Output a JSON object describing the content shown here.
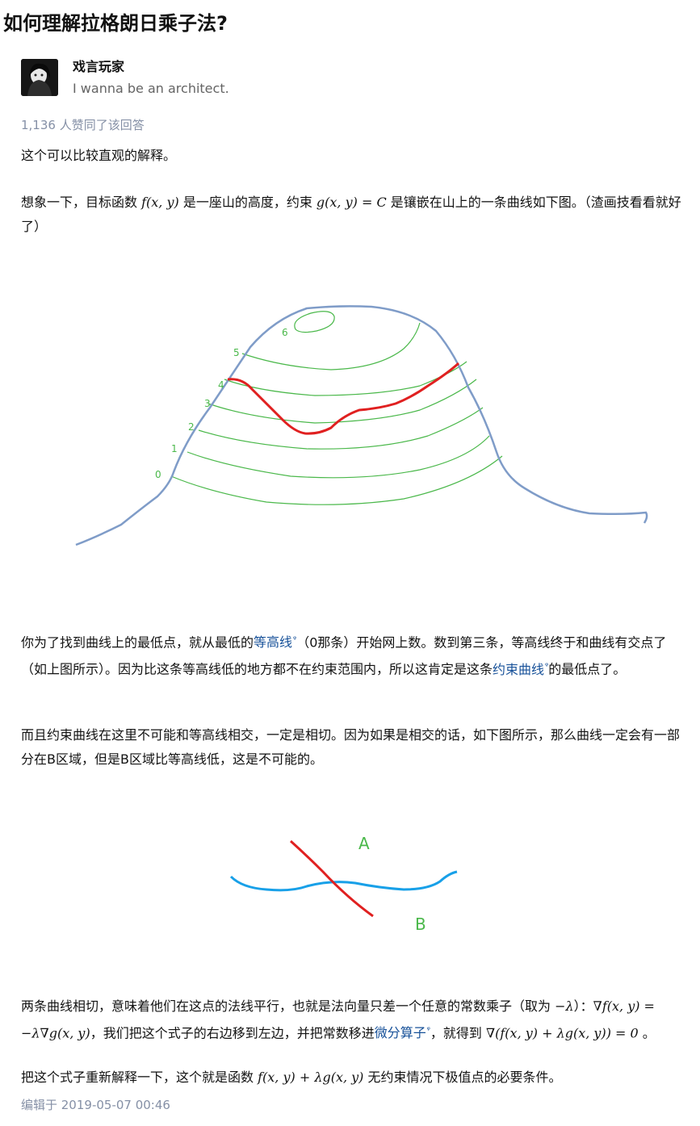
{
  "question": {
    "title": "如何理解拉格朗日乘子法?"
  },
  "author": {
    "name": "戏言玩家",
    "bio": "I wanna be an architect."
  },
  "answer": {
    "votes": "1,136 人赞同了该回答",
    "p1": "这个可以比较直观的解释。",
    "p2": {
      "a": "想象一下，目标函数 ",
      "m1": "f(x, y)",
      "b": " 是一座山的高度，约束 ",
      "m2": "g(x, y) = C",
      "c": " 是镶嵌在山上的一条曲线如下图。（渣画技看看就好了）"
    },
    "figure1": {
      "contour_labels": [
        "0",
        "1",
        "2",
        "3",
        "4",
        "5",
        "6"
      ]
    },
    "p3": {
      "a": "你为了找到曲线上的最低点，就从最低的",
      "link1": "等高线",
      "b": "（0那条）开始网上数。数到第三条，等高线终于和曲线有交点了（如上图所示）。因为比这条等高线低的地方都不在约束范围内，所以这肯定是这条",
      "link2": "约束曲线",
      "c": "的最低点了。"
    },
    "p4": "而且约束曲线在这里不可能和等高线相交，一定是相切。因为如果是相交的话，如下图所示，那么曲线一定会有一部分在B区域，但是B区域比等高线低，这是不可能的。",
    "figure2": {
      "label_a": "A",
      "label_b": "B"
    },
    "p5": {
      "a": "两条曲线相切，意味着他们在这点的法线平行，也就是法向量只差一个任意的常数乘子（取为 ",
      "m1": "−λ",
      "b": "）：",
      "m2": "∇f(x, y) = −λ∇g(x, y)",
      "c": "，我们把这个式子的右边移到左边，并把常数移进",
      "link": "微分算子",
      "d": "，就得到 ",
      "m3": "∇(f(x, y) + λg(x, y)) = 0",
      "e": " 。"
    },
    "p6": {
      "a": "把这个式子重新解释一下，这个就是函数 ",
      "m1": "f(x, y) + λg(x, y)",
      "b": " 无约束情况下极值点的必要条件。"
    },
    "edited": "编辑于 2019-05-07 00:46"
  },
  "colors": {
    "mountain": "#7f9cc8",
    "contour": "#4ab84a",
    "constraint": "#e02020",
    "blue_curve": "#18a0e8",
    "link": "#175199",
    "meta_gray": "#8590a6"
  },
  "icons": {
    "link_icon": "search-link-icon"
  }
}
